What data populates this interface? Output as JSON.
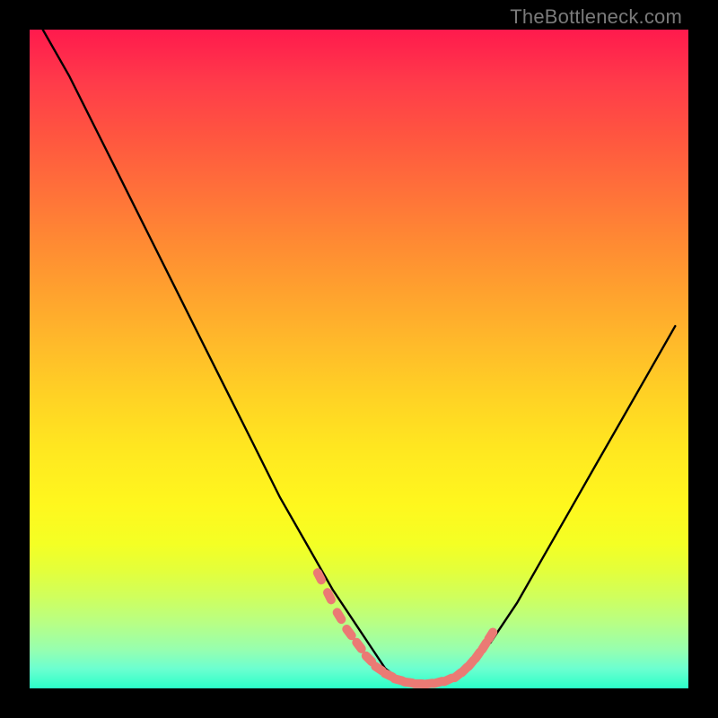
{
  "watermark": {
    "text": "TheBottleneck.com"
  },
  "colors": {
    "background": "#000000",
    "gradient_top": "#ff1a4d",
    "gradient_bottom": "#2bffc8",
    "curve": "#000000",
    "dots": "#eb7a74"
  },
  "chart_data": {
    "type": "line",
    "title": "",
    "xlabel": "",
    "ylabel": "",
    "xlim": [
      0,
      100
    ],
    "ylim": [
      0,
      100
    ],
    "series": [
      {
        "name": "bottleneck-curve",
        "x": [
          2,
          6,
          10,
          14,
          18,
          22,
          26,
          30,
          34,
          38,
          42,
          46,
          50,
          52,
          54,
          56,
          58,
          60,
          62,
          64,
          66,
          70,
          74,
          78,
          82,
          86,
          90,
          94,
          98
        ],
        "y": [
          100,
          93,
          85,
          77,
          69,
          61,
          53,
          45,
          37,
          29,
          22,
          15,
          9,
          6,
          3,
          1.5,
          0.7,
          0.5,
          0.7,
          1.5,
          3,
          7,
          13,
          20,
          27,
          34,
          41,
          48,
          55
        ]
      }
    ],
    "dot_cluster": {
      "name": "highlight-dots",
      "x": [
        44,
        45.5,
        47,
        48.5,
        50,
        51.5,
        53,
        54.5,
        56,
        57.5,
        59,
        60.5,
        62,
        63.5,
        65,
        66,
        67,
        68,
        69,
        70
      ],
      "y": [
        17,
        14,
        11,
        8.5,
        6.5,
        4.5,
        3,
        2,
        1.3,
        0.9,
        0.7,
        0.7,
        0.9,
        1.3,
        2,
        2.8,
        3.8,
        5,
        6.4,
        8
      ]
    }
  }
}
